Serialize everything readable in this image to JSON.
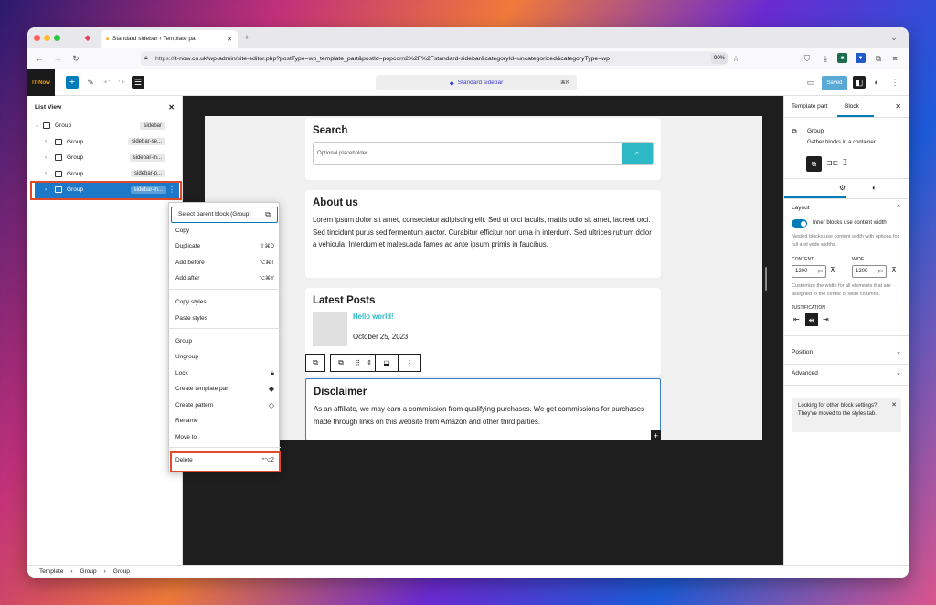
{
  "browser": {
    "tab_title": "Standard sidebar ‹ Template pa",
    "url_prefix": "https://",
    "url": "it-now.co.uk/wp-admin/site-editor.php?postType=wp_template_part&postId=popcorn2%2F%2Fstandard-sidebar&categoryId=uncategorized&categoryType=wp",
    "zoom": "90%"
  },
  "editor": {
    "logo_text": "IT-Now",
    "command_label": "Standard sidebar",
    "command_shortcut": "⌘K",
    "saved_label": "Saved"
  },
  "list_view": {
    "title": "List View",
    "rows": [
      {
        "label": "Group",
        "tag": "sidebar"
      },
      {
        "label": "Group",
        "tag": "sidebar-se..."
      },
      {
        "label": "Group",
        "tag": "sidebar-in..."
      },
      {
        "label": "Group",
        "tag": "sidebar-p..."
      },
      {
        "label": "Group",
        "tag": "sidebar-in..."
      }
    ]
  },
  "context_menu": {
    "select_parent": "Select parent block (Group)",
    "copy": "Copy",
    "duplicate": "Duplicate",
    "duplicate_sc": "⇧⌘D",
    "add_before": "Add before",
    "add_before_sc": "⌥⌘T",
    "add_after": "Add after",
    "add_after_sc": "⌥⌘Y",
    "copy_styles": "Copy styles",
    "paste_styles": "Paste styles",
    "group": "Group",
    "ungroup": "Ungroup",
    "lock": "Lock",
    "create_template_part": "Create template part",
    "create_pattern": "Create pattern",
    "rename": "Rename",
    "move_to": "Move to",
    "delete": "Delete",
    "delete_sc": "^⌥Z"
  },
  "canvas": {
    "search_title": "Search",
    "search_placeholder": "Optional placeholder...",
    "about_title": "About us",
    "about_text": "Lorem ipsum dolor sit amet, consectetur adipiscing elit. Sed ut orci iaculis, mattis odio sit amet, laoreet orci. Sed tincidunt purus sed fermentum auctor. Curabitur efficitur non urna in interdum. Sed ultrices rutrum dolor a vehicula. Interdum et malesuada fames ac ante ipsum primis in faucibus.",
    "posts_title": "Latest Posts",
    "post_link": "Hello world!",
    "post_date": "October 25, 2023",
    "disclaimer_title": "Disclaimer",
    "disclaimer_text": "As an affiliate, we may earn a commission from qualifying purchases. We get commissions for purchases made through links on this website from Amazon and other third parties."
  },
  "sidebar": {
    "tab_template_part": "Template part",
    "tab_block": "Block",
    "block_name": "Group",
    "block_desc": "Gather blocks in a container.",
    "layout_title": "Layout",
    "inner_blocks_label": "Inner blocks use content width",
    "inner_blocks_help": "Nested blocks use content width with options for full and wide widths.",
    "content_label": "CONTENT",
    "content_value": "1200",
    "wide_label": "WIDE",
    "wide_value": "1200",
    "unit": "px",
    "width_help": "Customize the width for all elements that are assigned to the center or wide columns.",
    "justification_label": "JUSTIFICATION",
    "position_label": "Position",
    "advanced_label": "Advanced",
    "notice_text": "Looking for other block settings? They've moved to the styles tab."
  },
  "breadcrumb": [
    "Template",
    "Group",
    "Group"
  ],
  "colors": {
    "accent": "#007cba",
    "highlight": "#e0492a",
    "teal": "#2cb9c5"
  }
}
